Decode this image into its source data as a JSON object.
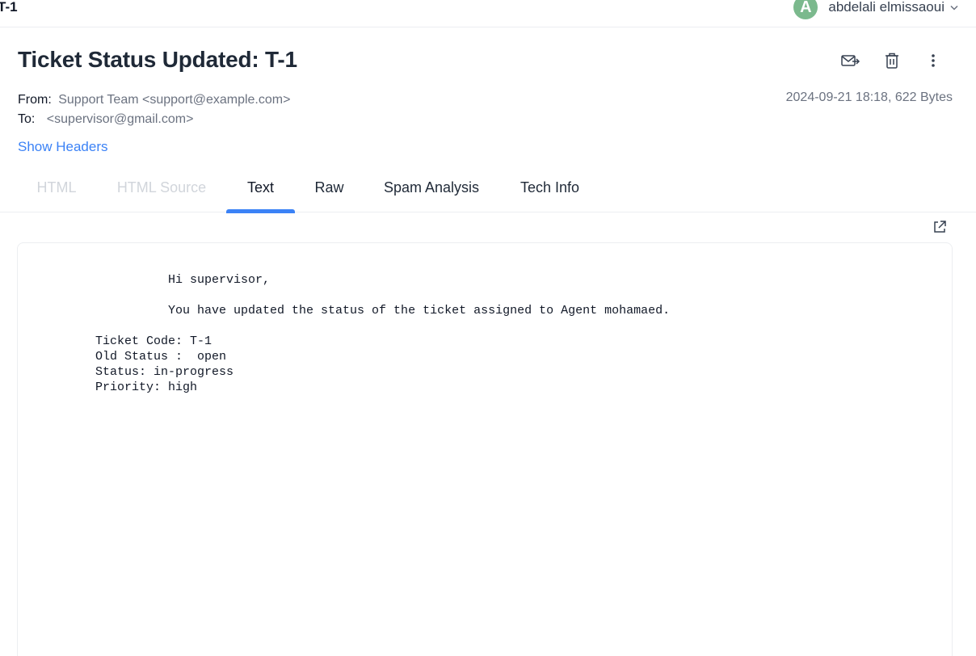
{
  "topbar": {
    "breadcrumb": "T-1",
    "user": {
      "avatar_letter": "A",
      "name": "abdelali elmissaoui",
      "avatar_color": "#7bb98d"
    }
  },
  "message": {
    "subject": "Ticket Status Updated: T-1",
    "from_label": "From:",
    "from_value": "Support Team <support@example.com>",
    "to_label": "To:",
    "to_value": "<supervisor@gmail.com>",
    "date_size": "2024-09-21 18:18, 622 Bytes",
    "show_headers": "Show Headers"
  },
  "actions": [
    {
      "name": "forward-icon",
      "icon": "envelope-forward"
    },
    {
      "name": "delete-icon",
      "icon": "trash"
    },
    {
      "name": "more-icon",
      "icon": "vertical-ellipsis"
    }
  ],
  "tabs": [
    {
      "label": "HTML",
      "state": "disabled"
    },
    {
      "label": "HTML Source",
      "state": "disabled"
    },
    {
      "label": "Text",
      "state": "active"
    },
    {
      "label": "Raw",
      "state": "normal"
    },
    {
      "label": "Spam Analysis",
      "state": "normal"
    },
    {
      "label": "Tech Info",
      "state": "normal"
    }
  ],
  "body_text": "          Hi supervisor,\n\n          You have updated the status of the ticket assigned to Agent mohamaed.\n\nTicket Code: T-1\nOld Status :  open\nStatus: in-progress\nPriority: high",
  "colors": {
    "accent": "#3b82f6",
    "text": "#1f2937",
    "muted": "#6b7280",
    "disabled": "#d1d5db"
  }
}
